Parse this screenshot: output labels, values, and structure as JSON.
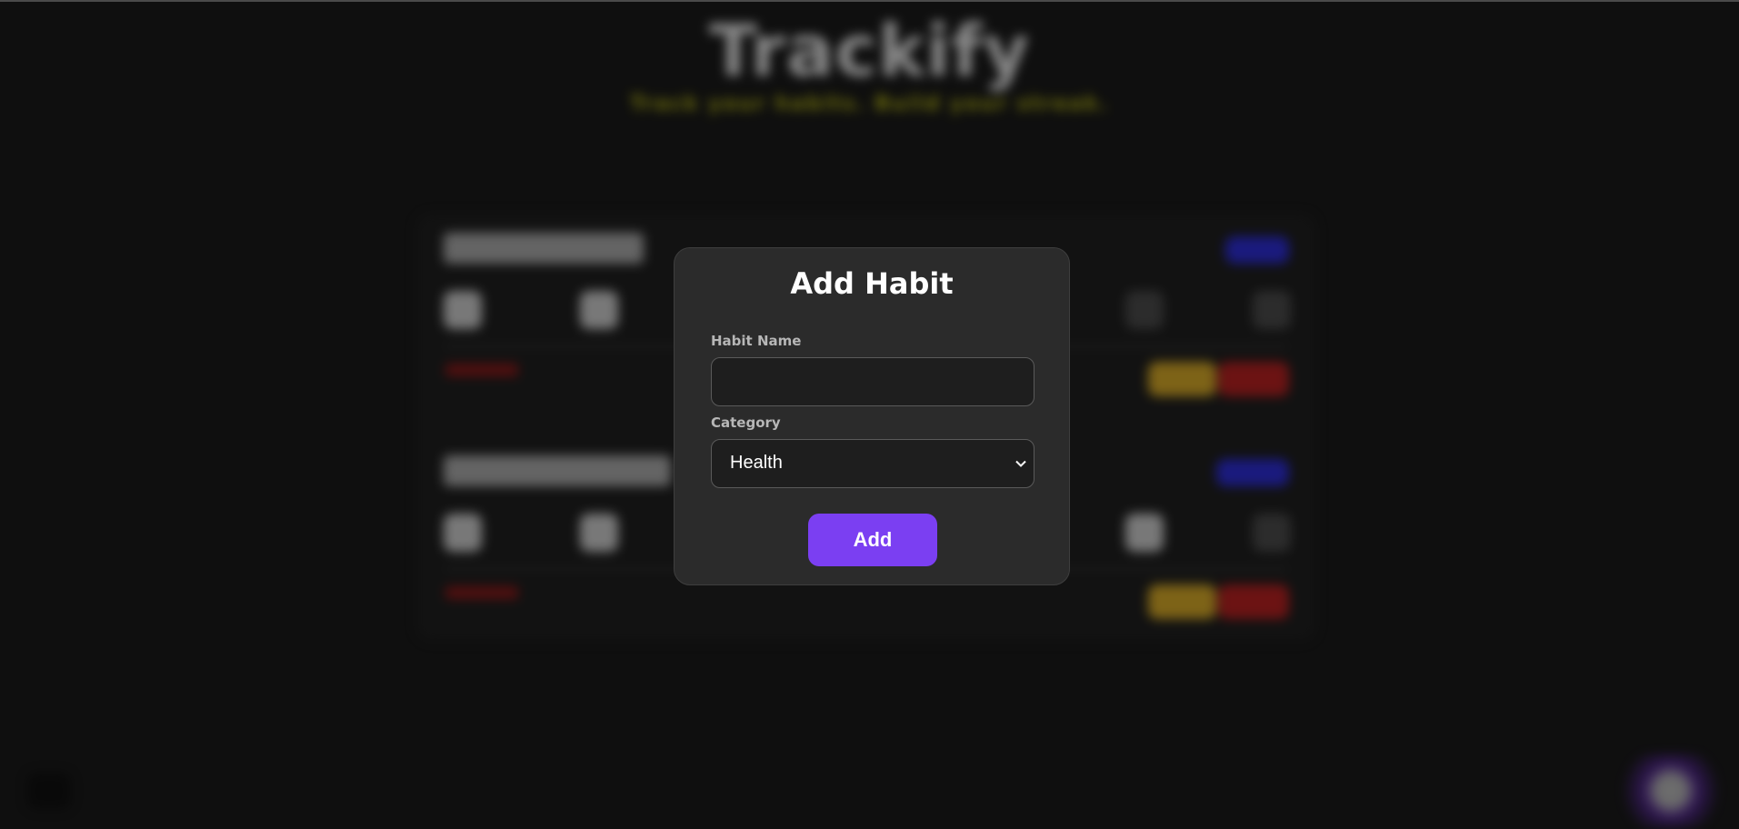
{
  "background": {
    "app_title": "Trackify",
    "app_subtitle": "Track your habits. Build your streak."
  },
  "modal": {
    "title": "Add Habit",
    "habit_name_label": "Habit Name",
    "habit_name_value": "",
    "habit_name_placeholder": "",
    "category_label": "Category",
    "category_value": "Health",
    "add_button_label": "Add"
  },
  "colors": {
    "accent": "#7b3ff2",
    "modal_bg": "#2b2b2b",
    "page_bg": "#0f0f0f"
  }
}
